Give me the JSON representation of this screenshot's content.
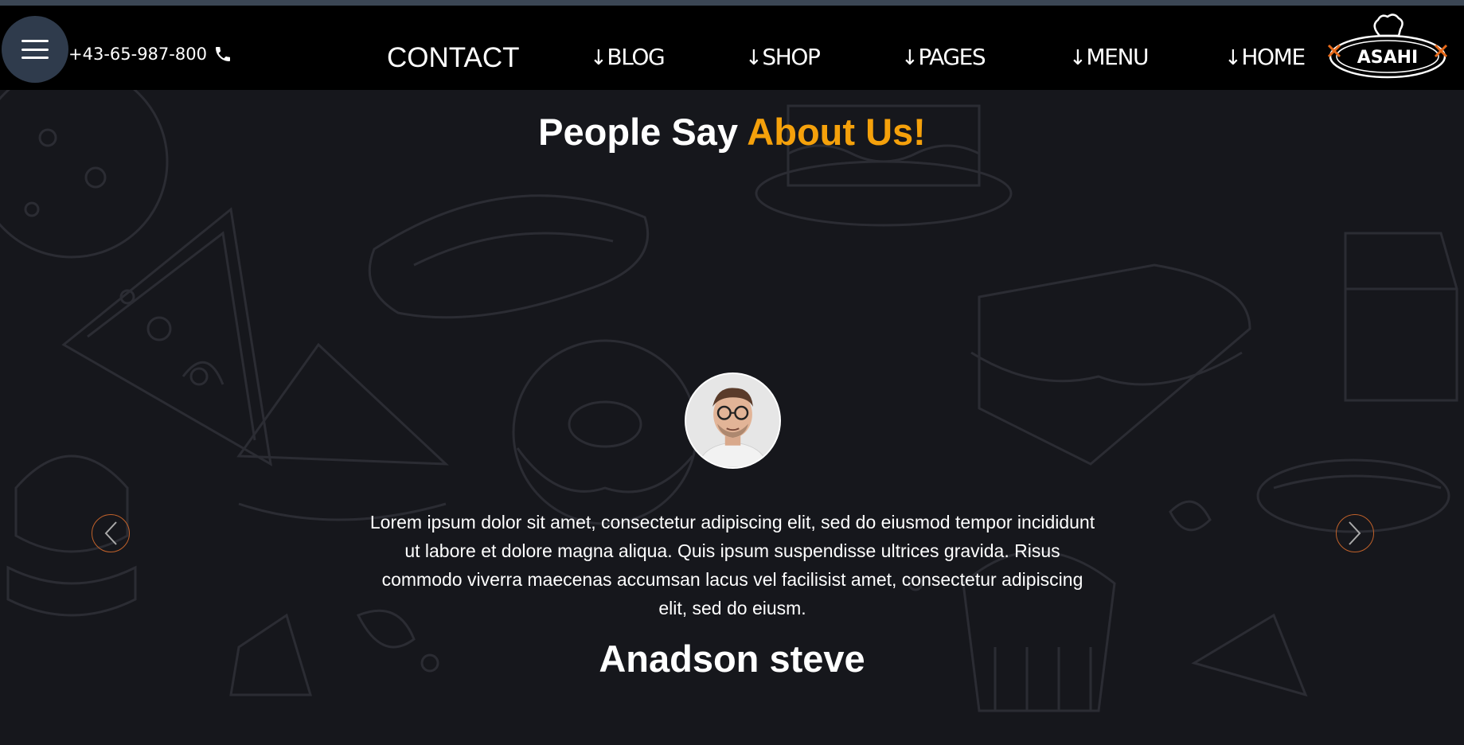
{
  "header": {
    "phone": "+43-65-987-800",
    "nav": [
      {
        "label": "CONTACT",
        "arrow": ""
      },
      {
        "label": "BLOG",
        "arrow": "↓"
      },
      {
        "label": "SHOP",
        "arrow": "↓"
      },
      {
        "label": "PAGES",
        "arrow": "↓"
      },
      {
        "label": "MENU",
        "arrow": "↓"
      },
      {
        "label": "HOME",
        "arrow": "↓"
      }
    ],
    "logo_text": "ASAHI"
  },
  "testimonials": {
    "heading_main": "People Say",
    "heading_accent": "About Us!",
    "quote": "Lorem ipsum dolor sit amet, consectetur adipiscing elit, sed do eiusmod tempor incididunt ut labore et dolore magna aliqua. Quis ipsum suspendisse ultrices gravida. Risus commodo viverra maecenas accumsan lacus vel facilisist amet, consectetur adipiscing elit, sed do eiusm.",
    "name": "Anadson steve"
  },
  "colors": {
    "accent": "#f5a10b",
    "background": "#16171c",
    "navbar": "#000000",
    "menu_button": "#2f3b4c",
    "arrow_ring": "#c0612a"
  }
}
